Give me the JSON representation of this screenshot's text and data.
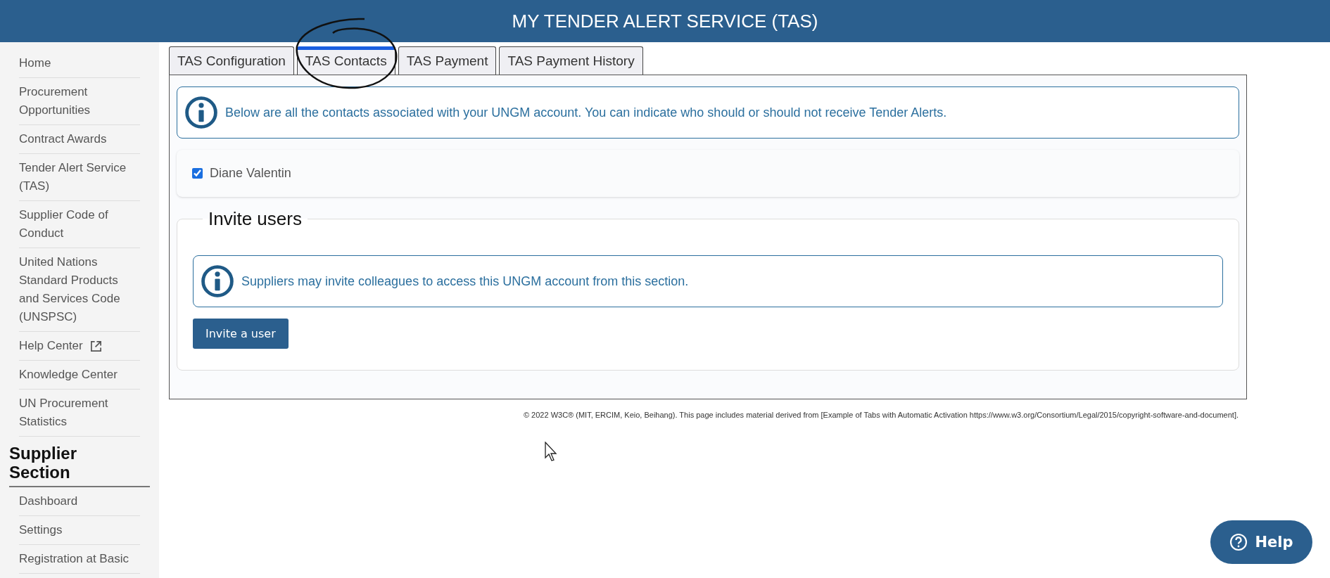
{
  "header": {
    "title": "MY TENDER ALERT SERVICE (TAS)"
  },
  "sidebar": {
    "items": [
      {
        "label": "Home",
        "external": false
      },
      {
        "label": "Procurement Opportunities",
        "external": false
      },
      {
        "label": "Contract Awards",
        "external": false
      },
      {
        "label": "Tender Alert Service (TAS)",
        "external": false
      },
      {
        "label": "Supplier Code of Conduct",
        "external": false
      },
      {
        "label": "United Nations Standard Products and Services Code (UNSPSC)",
        "external": false
      },
      {
        "label": "Help Center",
        "external": true
      },
      {
        "label": "Knowledge Center",
        "external": false
      },
      {
        "label": "UN Procurement Statistics",
        "external": false
      }
    ],
    "section_title": "Supplier Section",
    "section_items": [
      {
        "label": "Dashboard"
      },
      {
        "label": "Settings"
      },
      {
        "label": "Registration at Basic"
      }
    ]
  },
  "tabs": [
    {
      "label": "TAS Configuration",
      "selected": false
    },
    {
      "label": "TAS Contacts",
      "selected": true
    },
    {
      "label": "TAS Payment",
      "selected": false
    },
    {
      "label": "TAS Payment History",
      "selected": false
    }
  ],
  "contacts_info": "Below are all the contacts associated with your UNGM account. You can indicate who should or should not receive Tender Alerts.",
  "contacts": [
    {
      "name": "Diane Valentin",
      "checked": true
    }
  ],
  "invite": {
    "title": "Invite users",
    "info": "Suppliers may invite colleagues to access this UNGM account from this section.",
    "button": "Invite a user"
  },
  "footer": "© 2022 W3C® (MIT, ERCIM, Keio, Beihang). This page includes material derived from [Example of Tabs with Automatic Activation https://www.w3.org/Consortium/Legal/2015/copyright-software-and-document].",
  "help_button": "Help"
}
